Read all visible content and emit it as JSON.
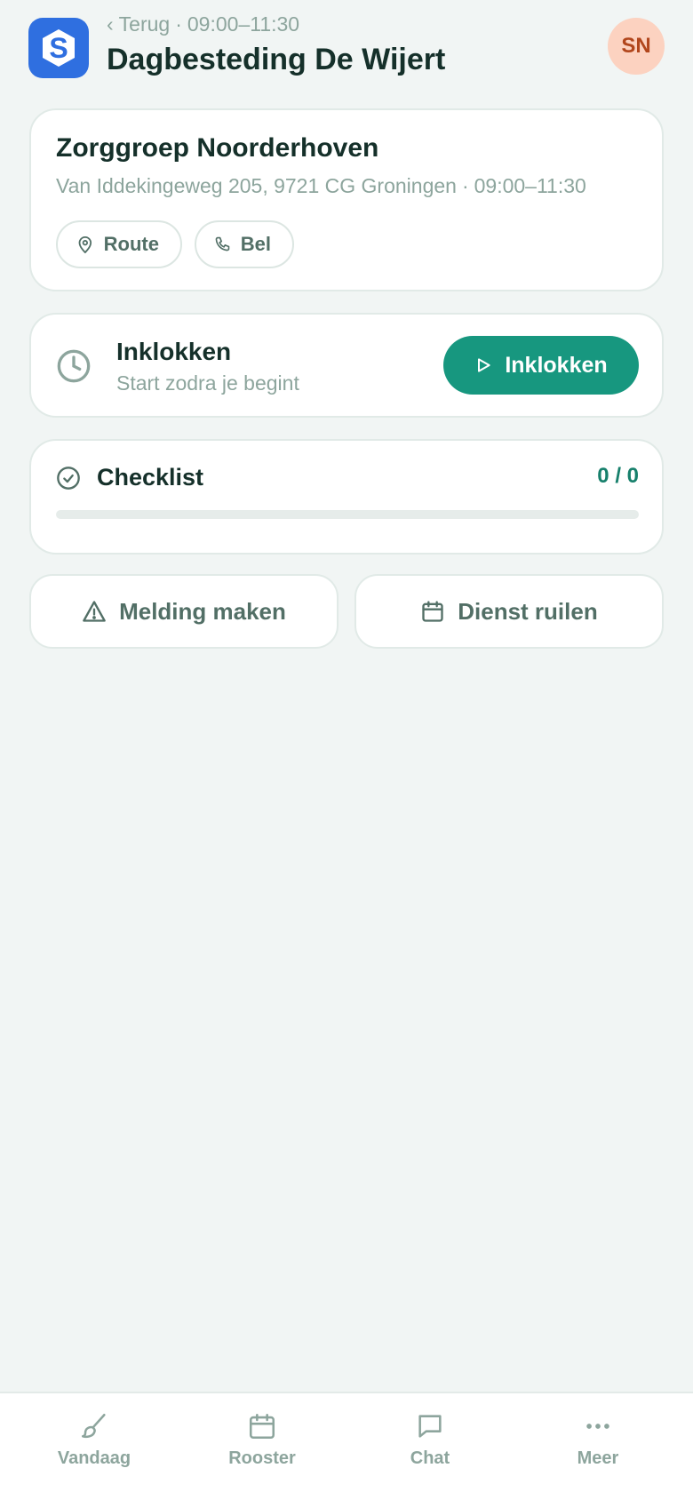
{
  "header": {
    "back_label": "Terug",
    "back_time": "09:00–11:30",
    "title": "Dagbesteding De Wijert",
    "avatar_initials": "SN",
    "logo_icon": "app-logo-s",
    "logo_letter": "S"
  },
  "location": {
    "name": "Zorggroep Noorderhoven",
    "address": "Van Iddekingeweg 205, 9721 CG Groningen",
    "time": "09:00–11:30",
    "route_label": "Route",
    "call_label": "Bel"
  },
  "clock": {
    "title": "Inklokken",
    "subtitle": "Start zodra je begint",
    "button_label": "Inklokken"
  },
  "checklist": {
    "title": "Checklist",
    "count": "0 / 0",
    "progress": 0
  },
  "actions": {
    "report_label": "Melding maken",
    "swap_label": "Dienst ruilen"
  },
  "nav": {
    "today": "Vandaag",
    "schedule": "Rooster",
    "chat": "Chat",
    "more": "Meer"
  },
  "colors": {
    "accent": "#17977f",
    "background": "#f1f5f4",
    "logo": "#2f6fe0",
    "avatar_bg": "#fcd2c0",
    "avatar_text": "#b1461c"
  }
}
